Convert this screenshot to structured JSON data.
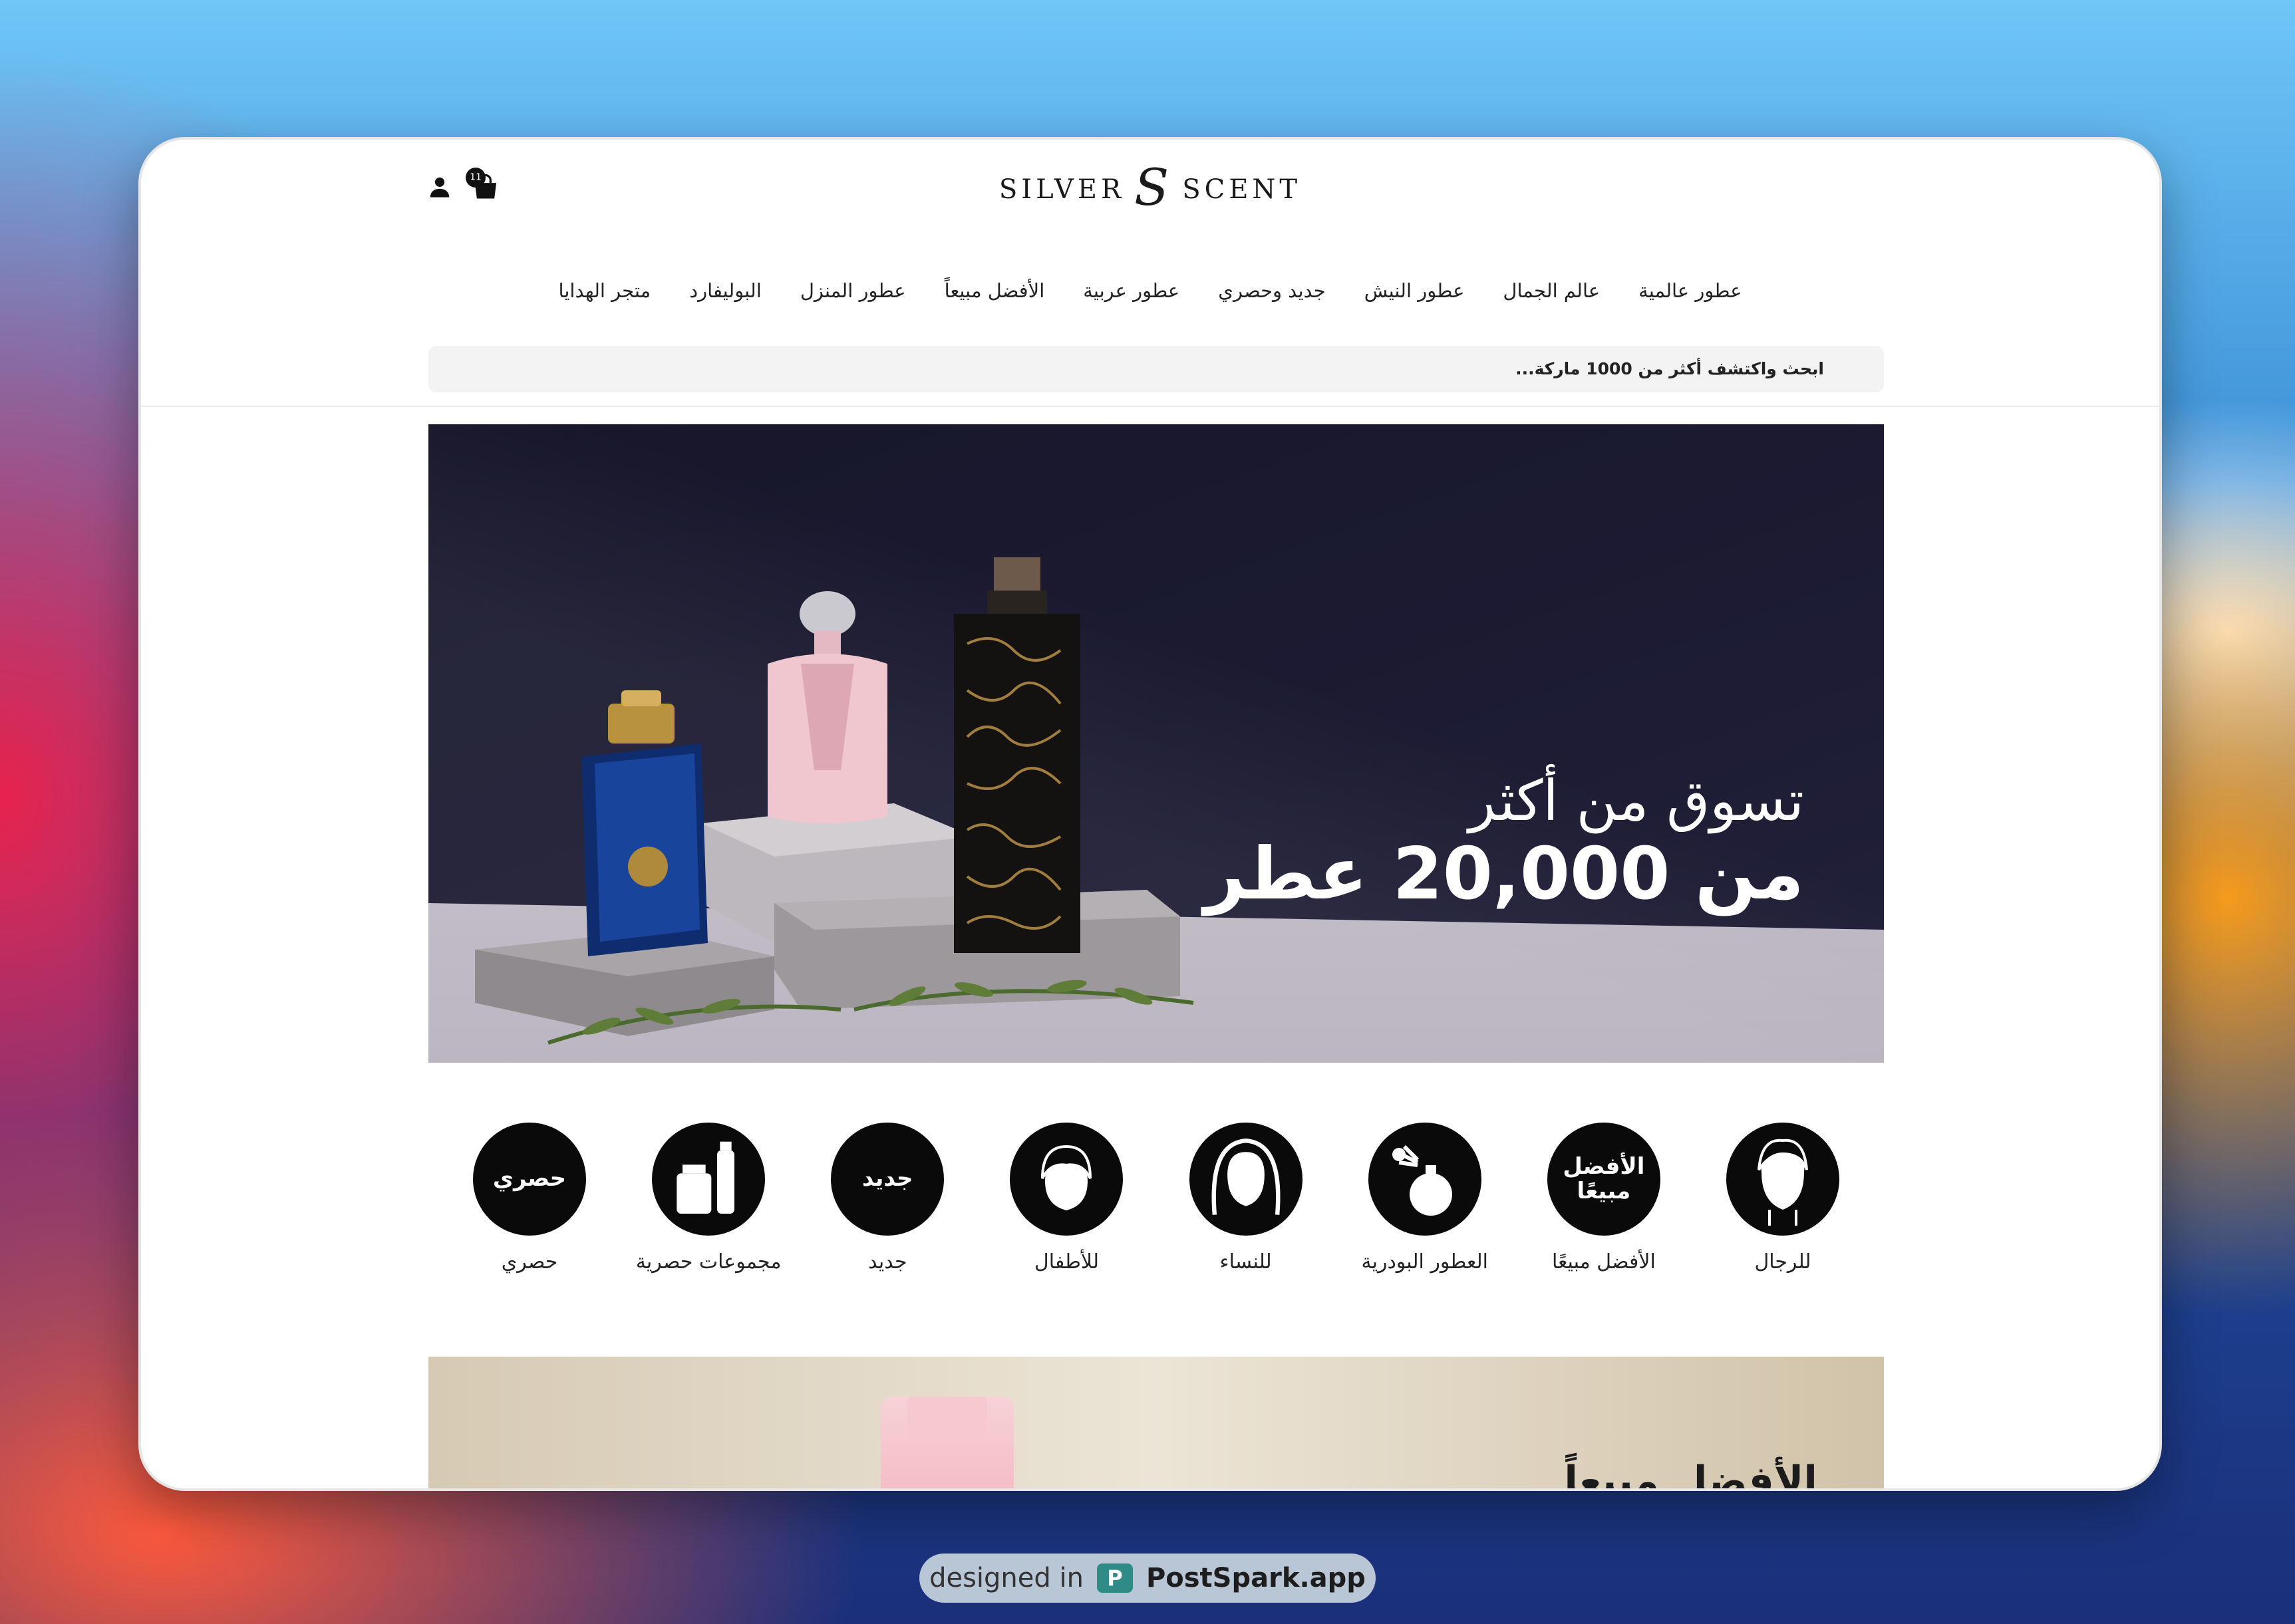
{
  "header": {
    "brand_left": "SILVER",
    "brand_mark": "S",
    "brand_right": "SCENT",
    "cart_count": "11"
  },
  "nav": {
    "items": [
      "عطور عالمية",
      "عالم الجمال",
      "عطور النيش",
      "جديد وحصري",
      "عطور عربية",
      "الأفضل مبيعاً",
      "عطور المنزل",
      "البوليفارد",
      "متجر الهدايا"
    ]
  },
  "search": {
    "placeholder": "ابحث واكتشف أكثر من 1000 ماركة..."
  },
  "hero": {
    "line1": "تسوق من أكثر",
    "line2": "من 20,000 عطر"
  },
  "categories": [
    {
      "label": "للرجال",
      "icon": "man-face-icon",
      "circle_text": ""
    },
    {
      "label": "الأفضل مبيعًا",
      "icon": "best-seller-text-icon",
      "circle_text": "الأفضل مبيعًا"
    },
    {
      "label": "العطور البودرية",
      "icon": "perfume-atomizer-icon",
      "circle_text": ""
    },
    {
      "label": "للنساء",
      "icon": "woman-face-icon",
      "circle_text": ""
    },
    {
      "label": "للأطفال",
      "icon": "child-face-icon",
      "circle_text": ""
    },
    {
      "label": "جديد",
      "icon": "new-text-icon",
      "circle_text": "جديد"
    },
    {
      "label": "مجموعات حصرية",
      "icon": "gift-set-icon",
      "circle_text": ""
    },
    {
      "label": "حصري",
      "icon": "exclusive-text-icon",
      "circle_text": "حصري"
    }
  ],
  "promo": {
    "heading": "الأفضل مبيعاً"
  },
  "watermark": {
    "prefix": "designed in",
    "logo_letter": "P",
    "brand": "PostSpark.app"
  }
}
